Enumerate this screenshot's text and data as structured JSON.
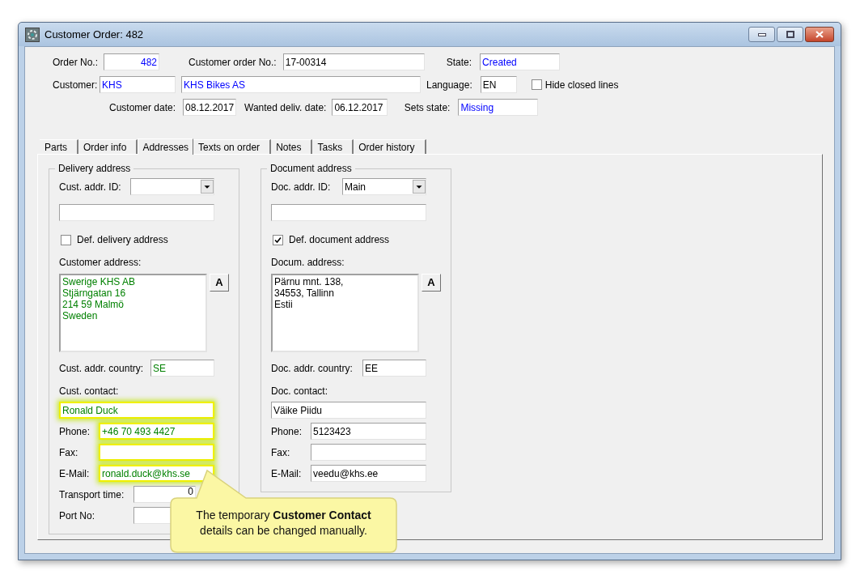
{
  "window": {
    "title": "Customer Order: 482"
  },
  "header": {
    "order_no": {
      "label": "Order No.:",
      "value": "482",
      "color": "#0000ff"
    },
    "customer_order_no": {
      "label": "Customer order No.:",
      "value": "17-00314",
      "color": "#000000"
    },
    "state": {
      "label": "State:",
      "value": "Created",
      "color": "#0000ff"
    },
    "customer": {
      "label": "Customer:",
      "code": "KHS",
      "name": "KHS Bikes AS",
      "color": "#0000ff"
    },
    "language": {
      "label": "Language:",
      "value": "EN",
      "color": "#000000"
    },
    "hide_closed_lines": {
      "label": "Hide closed lines",
      "checked": false
    },
    "customer_date": {
      "label": "Customer date:",
      "value": "08.12.2017",
      "color": "#000000"
    },
    "wanted_deliv_date": {
      "label": "Wanted deliv. date:",
      "value": "06.12.2017",
      "color": "#000000"
    },
    "sets_state": {
      "label": "Sets state:",
      "value": "Missing",
      "color": "#0000ff"
    }
  },
  "tabs": [
    {
      "label": "Parts",
      "selected": false
    },
    {
      "label": "Order info",
      "selected": false
    },
    {
      "label": "Addresses",
      "selected": true
    },
    {
      "label": "Texts on order",
      "selected": false
    },
    {
      "label": "Notes",
      "selected": false
    },
    {
      "label": "Tasks",
      "selected": false
    },
    {
      "label": "Order history",
      "selected": false
    }
  ],
  "delivery": {
    "title": "Delivery address",
    "addr_id": {
      "label": "Cust. addr. ID:"
    },
    "default": {
      "label": "Def. delivery address",
      "checked": false
    },
    "address": {
      "label": "Customer address:",
      "lines": [
        "Swerige KHS AB",
        "Stjärngatan 16",
        "214 59 Malmö",
        "Sweden"
      ],
      "color": "#008000",
      "button": "A"
    },
    "country": {
      "label": "Cust. addr. country:",
      "value": "SE",
      "color": "#008000"
    },
    "contact_label": "Cust. contact:",
    "contact": {
      "value": "Ronald Duck",
      "color": "#008000",
      "highlighted": true
    },
    "phone": {
      "label": "Phone:",
      "value": "+46 70 493 4427",
      "color": "#008000",
      "highlighted": true
    },
    "fax": {
      "label": "Fax:",
      "highlighted": true
    },
    "email": {
      "label": "E-Mail:",
      "value": "ronald.duck@khs.se",
      "color": "#008000",
      "highlighted": true
    },
    "transport_time": {
      "label": "Transport time:",
      "value": "0"
    },
    "port_no": {
      "label": "Port No:"
    }
  },
  "document": {
    "title": "Document address",
    "addr_id": {
      "label": "Doc. addr. ID:",
      "value": "Main"
    },
    "default": {
      "label": "Def. document address",
      "checked": true
    },
    "address": {
      "label": "Docum. address:",
      "lines": [
        "Pärnu mnt. 138,",
        "34553, Tallinn",
        "Estii"
      ],
      "color": "#000000",
      "button": "A"
    },
    "country": {
      "label": "Doc. addr. country:",
      "value": "EE",
      "color": "#000000"
    },
    "contact_label": "Doc. contact:",
    "contact": {
      "value": "Väike Piidu",
      "color": "#000000",
      "highlighted": false
    },
    "phone": {
      "label": "Phone:",
      "value": "5123423",
      "color": "#000000",
      "highlighted": false
    },
    "fax": {
      "label": "Fax:",
      "highlighted": false
    },
    "email": {
      "label": "E-Mail:",
      "value": "veedu@khs.ee",
      "color": "#000000",
      "highlighted": false
    }
  },
  "callout": {
    "text": "The temporary **Customer Contact** details can be changed manually."
  }
}
